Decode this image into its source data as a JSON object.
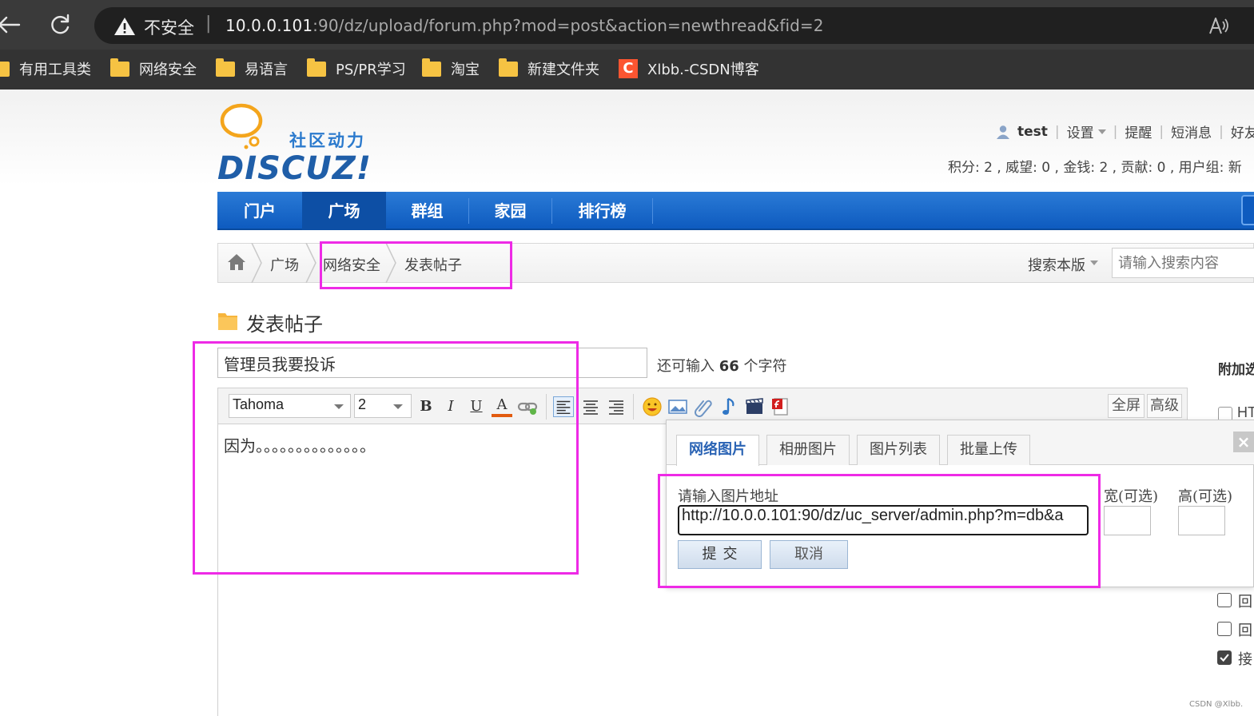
{
  "browser": {
    "security_label": "不安全",
    "url_separator": "|",
    "url_host": "10.0.0.101",
    "url_rest": ":90/dz/upload/forum.php?mod=post&action=newthread&fid=2",
    "bookmarks": [
      {
        "label": "有用工具类",
        "icon": "folder-icon"
      },
      {
        "label": "网络安全",
        "icon": "folder-icon"
      },
      {
        "label": "易语言",
        "icon": "folder-icon"
      },
      {
        "label": "PS/PR学习",
        "icon": "folder-icon"
      },
      {
        "label": "淘宝",
        "icon": "folder-icon"
      },
      {
        "label": "新建文件夹",
        "icon": "folder-icon"
      },
      {
        "label": "Xlbb.-CSDN博客",
        "icon": "csdn-icon",
        "icon_text": "C"
      }
    ]
  },
  "site": {
    "logo_subtitle": "社区动力",
    "logo_text": "DISCUZ!",
    "user": {
      "name": "test",
      "settings": "设置",
      "reminder": "提醒",
      "messages": "短消息",
      "friends": "好友",
      "separator": "|"
    },
    "stats": "积分: 2 , 威望: 0 , 金钱: 2 , 贡献: 0 , 用户组: 新",
    "nav": [
      "门户",
      "广场",
      "群组",
      "家园",
      "排行榜"
    ],
    "nav_active": "广场",
    "breadcrumb": [
      "广场",
      "网络安全",
      "发表帖子"
    ],
    "search_scope": "搜索本版",
    "search_placeholder": "请输入搜索内容"
  },
  "post": {
    "page_title": "发表帖子",
    "subject_value": "管理员我要投诉",
    "char_hint_prefix": "还可输入",
    "char_hint_count": "66",
    "char_hint_suffix": "个字符",
    "side_title": "附加选",
    "editor": {
      "font": "Tahoma",
      "size": "2",
      "bold": "B",
      "italic": "I",
      "underline": "U",
      "font_color": "A",
      "fullscreen": "全屏",
      "advanced": "高级",
      "content": "因为。。。。。。。。。。。。。。"
    },
    "side_options": [
      {
        "label": "HT",
        "checked": false
      },
      {
        "label": "回",
        "checked": false
      },
      {
        "label": "回",
        "checked": false
      },
      {
        "label": "接",
        "checked": true
      }
    ]
  },
  "image_dialog": {
    "tabs": [
      "网络图片",
      "相册图片",
      "图片列表",
      "批量上传"
    ],
    "active_tab": "网络图片",
    "close": "×",
    "url_label": "请输入图片地址",
    "url_value": "http://10.0.0.101:90/dz/uc_server/admin.php?m=db&a",
    "width_label": "宽(可选)",
    "height_label": "高(可选)",
    "submit": "提交",
    "cancel": "取消"
  },
  "watermark": "CSDN @Xlbb.",
  "colors": {
    "nav_blue": "#0e5bbf",
    "annotation_magenta": "#ee2ae6",
    "folder_yellow": "#f6c343",
    "csdn_red": "#fc5531"
  }
}
